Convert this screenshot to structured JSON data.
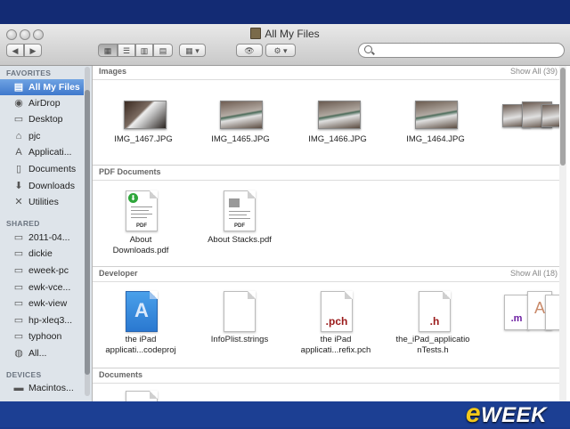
{
  "window": {
    "title": "All My Files"
  },
  "toolbar": {
    "back": "◀",
    "forward": "▶",
    "views": [
      "icon",
      "list",
      "column",
      "coverflow"
    ],
    "arrange": "▦ ▾",
    "quicklook": "👁",
    "action": "⚙ ▾",
    "search_placeholder": ""
  },
  "sidebar": {
    "favorites_title": "FAVORITES",
    "favorites": [
      {
        "label": "All My Files",
        "icon": "all-files-icon",
        "glyph": "▤"
      },
      {
        "label": "AirDrop",
        "icon": "airdrop-icon",
        "glyph": "◉"
      },
      {
        "label": "Desktop",
        "icon": "desktop-icon",
        "glyph": "▭"
      },
      {
        "label": "pjc",
        "icon": "home-icon",
        "glyph": "⌂"
      },
      {
        "label": "Applicati...",
        "icon": "applications-icon",
        "glyph": "A"
      },
      {
        "label": "Documents",
        "icon": "documents-icon",
        "glyph": "▯"
      },
      {
        "label": "Downloads",
        "icon": "downloads-icon",
        "glyph": "⬇"
      },
      {
        "label": "Utilities",
        "icon": "utilities-icon",
        "glyph": "✕"
      }
    ],
    "shared_title": "SHARED",
    "shared": [
      {
        "label": "2011-04...",
        "icon": "computer-icon",
        "glyph": "▭"
      },
      {
        "label": "dickie",
        "icon": "computer-icon",
        "glyph": "▭"
      },
      {
        "label": "eweek-pc",
        "icon": "computer-icon",
        "glyph": "▭"
      },
      {
        "label": "ewk-vce...",
        "icon": "computer-icon",
        "glyph": "▭"
      },
      {
        "label": "ewk-view",
        "icon": "computer-icon",
        "glyph": "▭"
      },
      {
        "label": "hp-xleq3...",
        "icon": "computer-icon",
        "glyph": "▭"
      },
      {
        "label": "typhoon",
        "icon": "computer-icon",
        "glyph": "▭"
      },
      {
        "label": "All...",
        "icon": "network-icon",
        "glyph": "◍"
      }
    ],
    "devices_title": "DEVICES",
    "devices": [
      {
        "label": "Macintos...",
        "icon": "harddisk-icon",
        "glyph": "▬"
      }
    ]
  },
  "sections": {
    "images": {
      "title": "Images",
      "show_all": "Show All (39)",
      "items": [
        "IMG_1467.JPG",
        "IMG_1465.JPG",
        "IMG_1466.JPG",
        "IMG_1464.JPG"
      ]
    },
    "pdf": {
      "title": "PDF Documents",
      "items": [
        {
          "line1": "About",
          "line2": "Downloads.pdf",
          "tag": "PDF"
        },
        {
          "line1": "About Stacks.pdf",
          "line2": "",
          "tag": "PDF"
        }
      ]
    },
    "developer": {
      "title": "Developer",
      "show_all": "Show All (18)",
      "items": [
        {
          "line1": "the iPad",
          "line2": "applicati...codeproj",
          "ext": ""
        },
        {
          "line1": "InfoPlist.strings",
          "line2": "",
          "ext": ""
        },
        {
          "line1": "the iPad",
          "line2": "applicati...refix.pch",
          "ext": ".pch"
        },
        {
          "line1": "the_iPad_applicatio",
          "line2": "nTests.h",
          "ext": ".h"
        }
      ],
      "stack_ext": ".m"
    },
    "documents": {
      "title": "Documents"
    }
  },
  "brand": {
    "prefix": "e",
    "name": "WEEK"
  }
}
